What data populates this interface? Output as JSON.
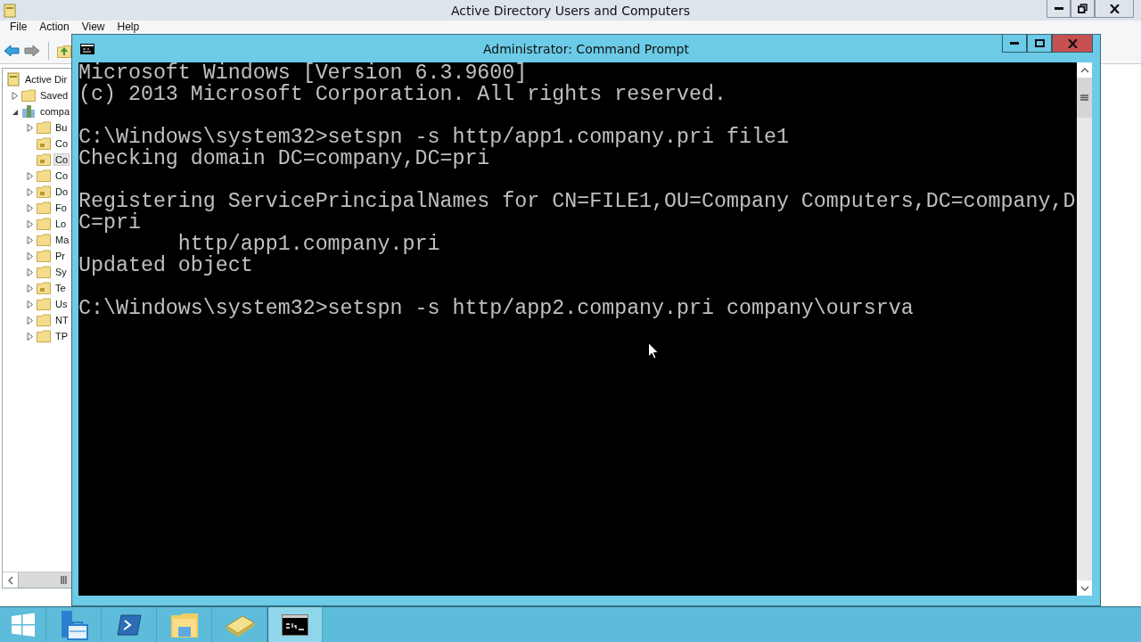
{
  "background_window": {
    "title": "Active Directory Users and Computers",
    "menu": [
      "File",
      "Action",
      "View",
      "Help"
    ],
    "tree": [
      {
        "label": "Active Dir",
        "kind": "console",
        "selected": false,
        "children": [
          {
            "label": "Saved",
            "kind": "folder",
            "expanded": false,
            "selected": false
          },
          {
            "label": "compa",
            "kind": "domain",
            "expanded": true,
            "selected": false,
            "children": [
              {
                "label": "Bu",
                "kind": "folder",
                "expanded": false,
                "selected": false
              },
              {
                "label": "Co",
                "kind": "ou",
                "selected": false
              },
              {
                "label": "Co",
                "kind": "ou",
                "selected": true
              },
              {
                "label": "Co",
                "kind": "folder",
                "expanded": false,
                "selected": false
              },
              {
                "label": "Do",
                "kind": "ou",
                "expanded": false,
                "selected": false
              },
              {
                "label": "Fo",
                "kind": "folder",
                "expanded": false,
                "selected": false
              },
              {
                "label": "Lo",
                "kind": "folder",
                "expanded": false,
                "selected": false
              },
              {
                "label": "Ma",
                "kind": "folder",
                "expanded": false,
                "selected": false
              },
              {
                "label": "Pr",
                "kind": "folder",
                "expanded": false,
                "selected": false
              },
              {
                "label": "Sy",
                "kind": "folder",
                "expanded": false,
                "selected": false
              },
              {
                "label": "Te",
                "kind": "ou",
                "expanded": false,
                "selected": false
              },
              {
                "label": "Us",
                "kind": "folder",
                "expanded": false,
                "selected": false
              },
              {
                "label": "NT",
                "kind": "folder",
                "expanded": false,
                "selected": false
              },
              {
                "label": "TP",
                "kind": "folder",
                "expanded": false,
                "selected": false
              }
            ]
          }
        ]
      }
    ]
  },
  "command_window": {
    "title": "Administrator: Command Prompt",
    "output_blocks": [
      [
        "Microsoft Windows [Version 6.3.9600]",
        "(c) 2013 Microsoft Corporation. All rights reserved."
      ],
      [
        "C:\\Windows\\system32>setspn -s http/app1.company.pri file1",
        "Checking domain DC=company,DC=pri"
      ],
      [
        "Registering ServicePrincipalNames for CN=FILE1,OU=Company Computers,DC=company,D",
        "C=pri",
        "        http/app1.company.pri",
        "Updated object"
      ],
      [
        "C:\\Windows\\system32>setspn -s http/app2.company.pri company\\oursrva"
      ]
    ]
  },
  "taskbar": [
    {
      "kind": "start",
      "selected": false
    },
    {
      "kind": "server-manager",
      "selected": false
    },
    {
      "kind": "powershell",
      "selected": false
    },
    {
      "kind": "explorer",
      "selected": false
    },
    {
      "kind": "notebook",
      "selected": false
    },
    {
      "kind": "cmd",
      "selected": true
    }
  ]
}
